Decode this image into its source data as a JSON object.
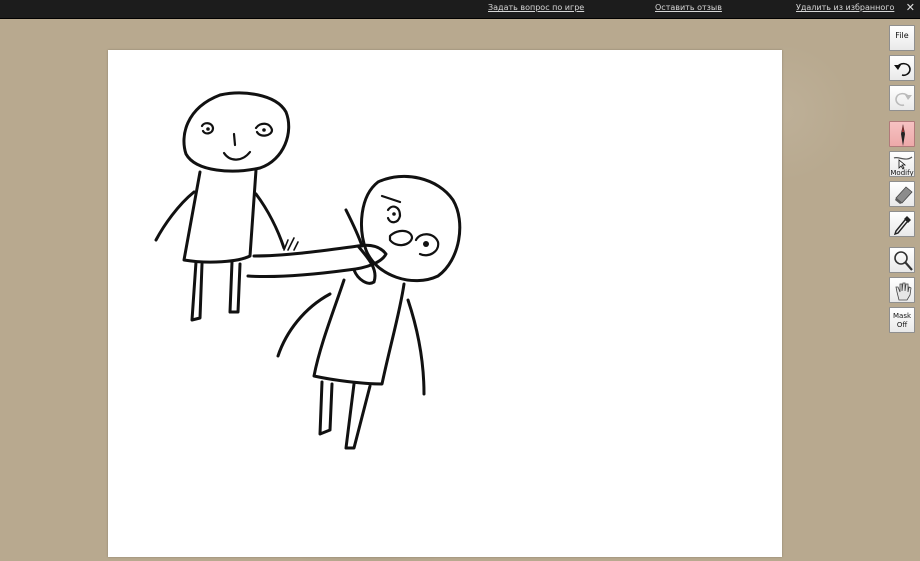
{
  "topbar": {
    "links": [
      {
        "label": "Задать вопрос по игре"
      },
      {
        "label": "Оставить отзыв"
      },
      {
        "label": "Удалить из избранного"
      }
    ],
    "close_symbol": "✕"
  },
  "toolbar": {
    "file_label": "File",
    "modify_label": "Modify",
    "mask_label_line1": "Mask",
    "mask_label_line2": "Off",
    "tools": [
      {
        "name": "file",
        "icon": "file-icon"
      },
      {
        "name": "undo",
        "icon": "undo-icon"
      },
      {
        "name": "redo",
        "icon": "redo-icon"
      },
      {
        "name": "brush",
        "icon": "brush-icon",
        "active": true
      },
      {
        "name": "modify",
        "icon": "modify-icon"
      },
      {
        "name": "eraser",
        "icon": "eraser-icon"
      },
      {
        "name": "eyedropper",
        "icon": "eyedropper-icon"
      },
      {
        "name": "zoom",
        "icon": "magnifier-icon"
      },
      {
        "name": "pan",
        "icon": "hand-icon"
      },
      {
        "name": "mask",
        "icon": "mask-icon"
      }
    ]
  },
  "colors": {
    "background": "#b8a98f",
    "topbar": "#1c1c1c",
    "active_tool": "#f3b8b8",
    "canvas": "#ffffff",
    "ink": "#111111"
  }
}
